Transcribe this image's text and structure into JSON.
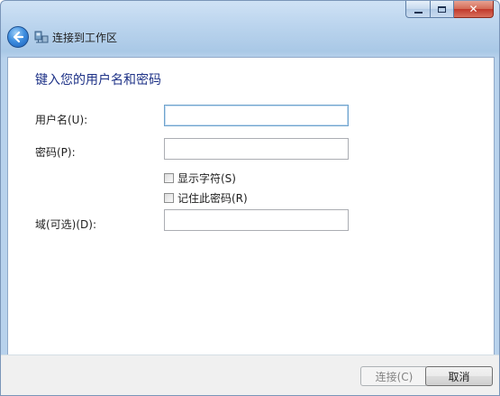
{
  "window": {
    "title": "连接到工作区",
    "caption_buttons": {
      "close_glyph": "✕"
    }
  },
  "main": {
    "heading": "键入您的用户名和密码",
    "fields": {
      "username": {
        "label": "用户名(U):",
        "value": ""
      },
      "password": {
        "label": "密码(P):",
        "value": ""
      },
      "domain": {
        "label": "域(可选)(D):",
        "value": ""
      }
    },
    "checkboxes": {
      "show_chars": {
        "label": "显示字符(S)",
        "checked": false
      },
      "remember_password": {
        "label": "记住此密码(R)",
        "checked": false
      }
    }
  },
  "footer": {
    "connect_label": "连接(C)",
    "connect_enabled": false,
    "cancel_label": "取消"
  },
  "icons": {
    "back": "back-arrow-icon",
    "network": "network-workplace-icon",
    "minimize": "minimize-icon",
    "maximize": "maximize-icon",
    "close": "close-icon"
  },
  "colors": {
    "heading": "#1e3287",
    "titlebar": "#bcd5ee",
    "close_button": "#c0392b",
    "back_button": "#3f8fe0"
  }
}
